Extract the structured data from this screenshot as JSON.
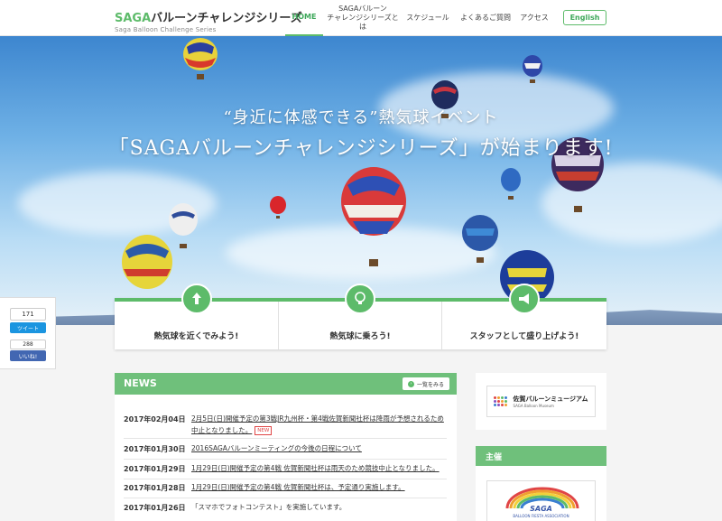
{
  "header": {
    "logo_accent": "SAGA",
    "logo_rest": "バルーンチャレンジシリーズ",
    "logo_sub": "Saga Balloon Challenge Series",
    "nav": [
      {
        "label": "HOME",
        "active": true
      },
      {
        "label": "SAGAバルーン\nチャレンジシリーズとは",
        "active": false
      },
      {
        "label": "スケジュール",
        "active": false
      },
      {
        "label": "よくあるご質問",
        "active": false
      },
      {
        "label": "アクセス",
        "active": false
      }
    ],
    "lang_button": "English"
  },
  "hero": {
    "line1": "“身近に体感できる”熱気球イベント",
    "line2": "「SAGAバルーンチャレンジシリーズ」が始まります!"
  },
  "features": [
    {
      "label": "熱気球を近くでみよう!",
      "icon": "hand-pointer-icon"
    },
    {
      "label": "熱気球に乗ろう!",
      "icon": "lightbulb-icon"
    },
    {
      "label": "スタッフとして盛り上げよう!",
      "icon": "megaphone-icon"
    }
  ],
  "social": {
    "tweet_count": "171",
    "tweet_label": "ツイート",
    "like_count": "288",
    "like_label": "いいね!"
  },
  "news": {
    "title": "NEWS",
    "view_all": "一覧をみる",
    "new_badge": "NEW",
    "items": [
      {
        "date": "2017年02月04日",
        "text": "2月5日(日)開催予定の第3戦JR九州杯・第4戦佐賀新聞社杯は降雨が予想されるため中止となりました。",
        "new": true
      },
      {
        "date": "2017年01月30日",
        "text": "2016SAGAバルーンミーティングの今後の日程について",
        "new": false
      },
      {
        "date": "2017年01月29日",
        "text": "1月29日(日)開催予定の第4戦 佐賀新聞社杯は雨天のため競技中止となりました。",
        "new": false
      },
      {
        "date": "2017年01月28日",
        "text": "1月29日(日)開催予定の第4戦 佐賀新聞社杯は、予定通り実施します。",
        "new": false
      },
      {
        "date": "2017年01月26日",
        "text": "「スマホでフォトコンテスト」を実施しています。",
        "new": false
      }
    ]
  },
  "sidebar": {
    "museum_name": "佐賀バルーンミュージアム",
    "museum_sub": "SAGA Balloon Museum",
    "sponsor_header": "主催",
    "sponsor_name": "SAGA",
    "sponsor_sub": "BALLOON FIESTA ASSOCIATION"
  },
  "colors": {
    "accent": "#5dbb6a",
    "header_green": "#6fc07b",
    "twitter": "#1b95e0",
    "facebook": "#4267b2",
    "new_badge": "#e04545"
  }
}
